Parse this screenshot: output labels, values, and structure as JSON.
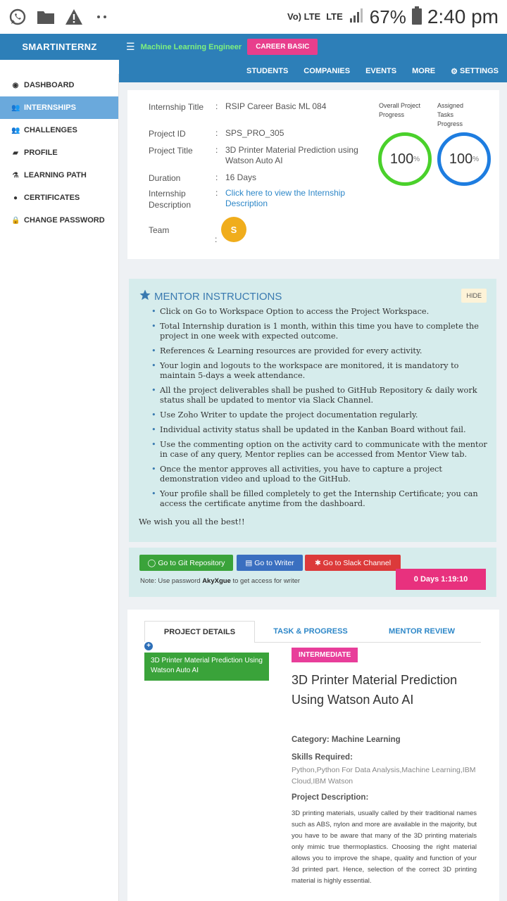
{
  "status_bar": {
    "volte": "Vo) LTE",
    "lte": "LTE",
    "battery": "67%",
    "time": "2:40 pm"
  },
  "nav": {
    "brand": "SMARTINTERNZ",
    "role": "Machine Learning Engineer",
    "career_badge": "CAREER BASIC",
    "links": [
      "STUDENTS",
      "COMPANIES",
      "EVENTS",
      "MORE",
      "SETTINGS"
    ]
  },
  "sidebar": {
    "items": [
      {
        "label": "DASHBOARD",
        "icon": "dashboard-icon"
      },
      {
        "label": "INTERNSHIPS",
        "icon": "users-icon"
      },
      {
        "label": "CHALLENGES",
        "icon": "users-icon"
      },
      {
        "label": "PROFILE",
        "icon": "chat-icon"
      },
      {
        "label": "LEARNING PATH",
        "icon": "flask-icon"
      },
      {
        "label": "CERTIFICATES",
        "icon": "circle-icon"
      },
      {
        "label": "CHANGE PASSWORD",
        "icon": "lock-icon"
      }
    ],
    "active_index": 1
  },
  "project": {
    "internship_title_label": "Internship Title",
    "internship_title": "RSIP Career Basic ML 084",
    "project_id_label": "Project ID",
    "project_id": "SPS_PRO_305",
    "project_title_label": "Project Title",
    "project_title": "3D Printer Material Prediction using Watson Auto AI",
    "duration_label": "Duration",
    "duration": "16 Days",
    "description_label": "Internship Description",
    "description_link": "Click here to view the Internship Description",
    "team_label": "Team",
    "team_avatar": "S",
    "overall_label": "Overall Project Progress",
    "overall_value": "100",
    "assigned_label": "Assigned Tasks Progress",
    "assigned_value": "100",
    "percent_sign": "%"
  },
  "mentor": {
    "title": "MENTOR INSTRUCTIONS",
    "hide_label": "HIDE",
    "items": [
      "Click on Go to Workspace Option to access the Project Workspace.",
      "Total Internship duration is 1 month, within this time you have to complete the project in one week with expected outcome.",
      "References & Learning resources are provided for every activity.",
      "Your login and logouts to the workspace are monitored, it is mandatory to maintain 5-days a week attendance.",
      "All the project deliverables shall be pushed to GitHub Repository & daily work status shall be updated to mentor via Slack Channel.",
      "Use Zoho Writer to update the project documentation regularly.",
      "Individual activity status shall be updated in the Kanban Board without fail.",
      "Use the commenting option on the activity card to communicate with the mentor in case of any query, Mentor replies can be accessed from Mentor View tab.",
      "Once the mentor approves all activities, you have to capture a project demonstration video and upload to the GitHub.",
      "Your profile shall be filled completely to get the Internship Certificate; you can access the certificate anytime from the dashboard."
    ],
    "footer": "We wish you all the best!!"
  },
  "actions": {
    "git_label": "Go to Git Repository",
    "writer_label": "Go to Writer",
    "slack_label": "Go to Slack Channel",
    "note_prefix": "Note: Use password ",
    "note_password": "AkyXgue",
    "note_suffix": " to get access for writer",
    "timer": "0 Days 1:19:10",
    "colors": {
      "git": "#3aa33a",
      "writer": "#3a6fc0",
      "slack": "#dc3a3a"
    }
  },
  "details": {
    "tabs": [
      "PROJECT DETAILS",
      "TASK & PROGRESS",
      "MENTOR REVIEW"
    ],
    "active_tab": 0,
    "plus_symbol": "+",
    "project_pill": "3D Printer Material Prediction Using Watson Auto AI",
    "level": "INTERMEDIATE",
    "name": "3D Printer Material Prediction Using Watson Auto AI",
    "category": "Category: Machine Learning",
    "skills_heading": "Skills Required:",
    "skills": "Python,Python For Data Analysis,Machine Learning,IBM Cloud,IBM Watson",
    "description_heading": "Project Description:",
    "description": "3D printing materials, usually called by their traditional names such as ABS, nylon and more are available in the majority, but you have to be aware that many of the 3D printing materials only mimic true thermoplastics. Choosing the right material allows you to improve the shape, quality and function of your 3d printed part. Hence, selection of the correct 3D printing material is highly essential."
  }
}
